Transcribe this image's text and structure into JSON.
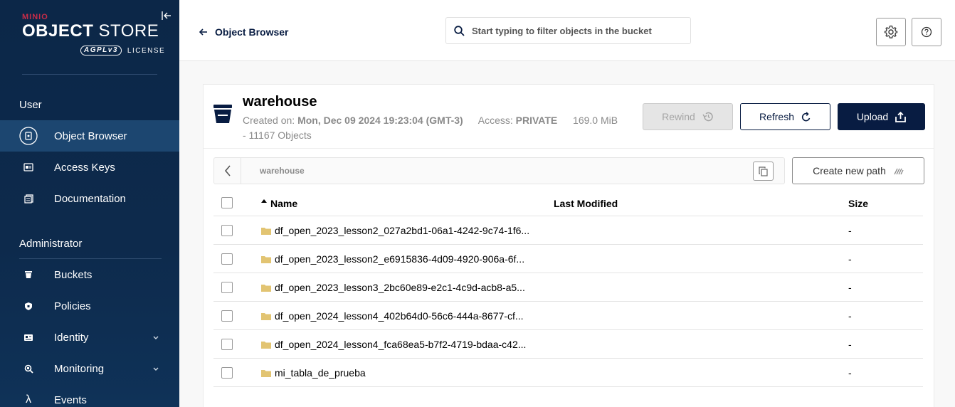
{
  "sidebar": {
    "brand_small": "MINIO",
    "brand_title_bold": "OBJECT",
    "brand_title_light": " STORE",
    "license_badge": "AGPLv3",
    "license_text": "LICENSE",
    "sections": {
      "user": "User",
      "admin": "Administrator"
    },
    "items": [
      {
        "label": "Object Browser",
        "icon": "object-browser-icon",
        "active": true
      },
      {
        "label": "Access Keys",
        "icon": "access-keys-icon"
      },
      {
        "label": "Documentation",
        "icon": "documentation-icon"
      },
      {
        "label": "Buckets",
        "icon": "buckets-icon"
      },
      {
        "label": "Policies",
        "icon": "policies-icon"
      },
      {
        "label": "Identity",
        "icon": "identity-icon",
        "expandable": true
      },
      {
        "label": "Monitoring",
        "icon": "monitoring-icon",
        "expandable": true
      },
      {
        "label": "Events",
        "icon": "lambda-icon"
      }
    ]
  },
  "header": {
    "back_label": "Object Browser",
    "search_placeholder": "Start typing to filter objects in the bucket"
  },
  "bucket": {
    "name": "warehouse",
    "created_label": "Created on: ",
    "created_value": "Mon, Dec 09 2024 19:23:04 (GMT-3)",
    "access_label": "Access: ",
    "access_value": "PRIVATE",
    "size": "169.0 MiB",
    "objects": "- 11167 Objects",
    "buttons": {
      "rewind": "Rewind",
      "refresh": "Refresh",
      "upload": "Upload"
    }
  },
  "path": {
    "current": "warehouse",
    "create_new_path": "Create new path"
  },
  "table": {
    "columns": {
      "name": "Name",
      "modified": "Last Modified",
      "size": "Size"
    },
    "rows": [
      {
        "name": "df_open_2023_lesson2_027a2bd1-06a1-4242-9c74-1f6...",
        "modified": "",
        "size": "-"
      },
      {
        "name": "df_open_2023_lesson2_e6915836-4d09-4920-906a-6f...",
        "modified": "",
        "size": "-"
      },
      {
        "name": "df_open_2023_lesson3_2bc60e89-e2c1-4c9d-acb8-a5...",
        "modified": "",
        "size": "-"
      },
      {
        "name": "df_open_2024_lesson4_402b64d0-56c6-444a-8677-cf...",
        "modified": "",
        "size": "-"
      },
      {
        "name": "df_open_2024_lesson4_fca68ea5-b7f2-4719-bdaa-c42...",
        "modified": "",
        "size": "-"
      },
      {
        "name": "mi_tabla_de_prueba",
        "modified": "",
        "size": "-"
      }
    ]
  },
  "colors": {
    "sidebar_bg": "#0c2748",
    "sidebar_active": "#1c4670",
    "primary": "#081c42",
    "brand_red": "#c72c48",
    "folder": "#e2c472"
  }
}
